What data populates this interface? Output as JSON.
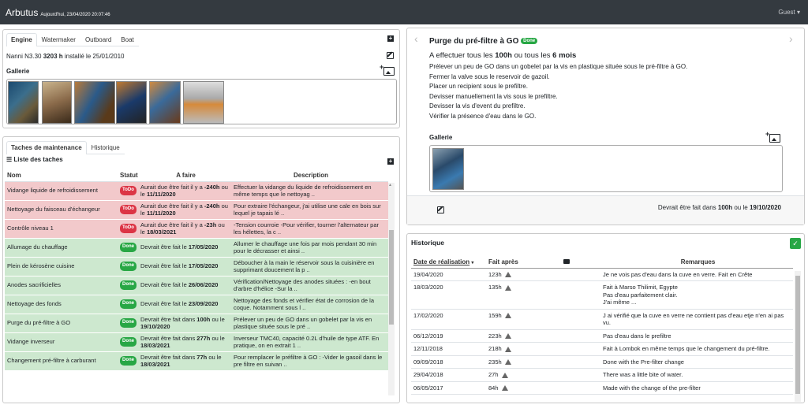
{
  "app": {
    "title": "Arbutus",
    "date": "Aujourd'hui, 23/04/2020 20:07:46",
    "user": "Guest"
  },
  "engine_card": {
    "tabs": [
      "Engine",
      "Watermaker",
      "Outboard",
      "Boat"
    ],
    "engine_model": "Nanni N3.30",
    "engine_hours": "3203 h",
    "installed_text": "installé le 25/01/2010",
    "gallery_label": "Gallerie"
  },
  "tasks_card": {
    "tabs": [
      "Taches de maintenance",
      "Historique"
    ],
    "list_title": "Liste des taches",
    "headers": [
      "Nom",
      "Statut",
      "A faire",
      "Description"
    ],
    "rows": [
      {
        "name": "Vidange liquide de refroidissement",
        "status": "ToDo",
        "todo_pre": "Aurait due être fait il y a",
        "todo_bold": "-240h",
        "todo_mid": "ou le",
        "todo_date": "11/11/2020",
        "description": "Effectuer la vidange du liquide de refroidissement en même temps que le nettoyag ..",
        "state": "red"
      },
      {
        "name": "Nettoyage du faisceau d'échangeur",
        "status": "ToDo",
        "todo_pre": "Aurait due être fait il y a",
        "todo_bold": "-240h",
        "todo_mid": "ou le",
        "todo_date": "11/11/2020",
        "description": "Pour extraire l'échangeur, j'ai utilise une cale en bois sur lequel je tapais lé ..",
        "state": "red"
      },
      {
        "name": "Contrôle niveau 1",
        "status": "ToDo",
        "todo_pre": "Aurait due être fait il y a",
        "todo_bold": "-23h",
        "todo_mid": "ou le",
        "todo_date": "18/03/2021",
        "description": "-Tension courroie -Pour vérifier, tourner l'alternateur par les hélettes, la c ..",
        "state": "red"
      },
      {
        "name": "Allumage du chauffage",
        "status": "Done",
        "todo_pre": "Devrait être fait le",
        "todo_bold": "",
        "todo_mid": "",
        "todo_date": "17/05/2020",
        "description": "Allumer le chauffage une fois par mois pendant 30 min pour le décrasser et ainsi ..",
        "state": "green"
      },
      {
        "name": "Plein de kérosène cuisine",
        "status": "Done",
        "todo_pre": "Devrait être fait le",
        "todo_bold": "",
        "todo_mid": "",
        "todo_date": "17/05/2020",
        "description": "Déboucher à la main le réservoir sous la cuisinière en supprimant doucement la p ..",
        "state": "green"
      },
      {
        "name": "Anodes sacrificielles",
        "status": "Done",
        "todo_pre": "Devrait être fait le",
        "todo_bold": "",
        "todo_mid": "",
        "todo_date": "26/06/2020",
        "description": "Vérification/Nettoyage des anodes situées : -en bout d'arbre d'hélice -Sur la ..",
        "state": "green"
      },
      {
        "name": "Nettoyage des fonds",
        "status": "Done",
        "todo_pre": "Devrait être fait le",
        "todo_bold": "",
        "todo_mid": "",
        "todo_date": "23/09/2020",
        "description": "Nettoyage des fonds et vérifier état de corrosion de la coque. Notamment sous l ..",
        "state": "green"
      },
      {
        "name": "Purge du pré-filtre à GO",
        "status": "Done",
        "todo_pre": "Devrait être fait dans",
        "todo_bold": "100h",
        "todo_mid": "ou le",
        "todo_date": "19/10/2020",
        "description": "Prélever un peu de GO dans un gobelet par la vis en plastique située sous le pré ..",
        "state": "green"
      },
      {
        "name": "Vidange inverseur",
        "status": "Done",
        "todo_pre": "Devrait être fait dans",
        "todo_bold": "277h",
        "todo_mid": "ou le",
        "todo_date": "18/03/2021",
        "description": "Inverseur TMC40, capacité 0.2L d'huile de type ATF. En pratique, on en extrait 1 ..",
        "state": "green"
      },
      {
        "name": "Changement pré-filtre à carburant",
        "status": "Done",
        "todo_pre": "Devrait être fait dans",
        "todo_bold": "77h",
        "todo_mid": "ou le",
        "todo_date": "18/03/2021",
        "description": "Pour remplacer le préfiltre à GO : -Vider le gasoil dans le pre filtre en suivan ..",
        "state": "green"
      }
    ]
  },
  "detail_card": {
    "title": "Purge du pré-filtre à GO",
    "badge": "Done",
    "freq_pre": "A effectuer tous les",
    "freq_hours": "100h",
    "freq_mid": "ou tous les",
    "freq_months": "6 mois",
    "steps": [
      "Prélever un peu de GO dans un gobelet par la vis en plastique située sous le pré-filtre à GO.",
      "Fermer la valve sous le reservoir de gazoil.",
      "Placer un recipient sous le prefiltre.",
      "Devisser manuellement la vis sous le prefiltre.",
      "Devisser la vis d'event du prefiltre.",
      "Vérifier la présence d'eau dans le GO."
    ],
    "gallery_label": "Gallerie",
    "due_pre": "Devrait être fait dans",
    "due_hours": "100h",
    "due_mid": "ou le",
    "due_date": "19/10/2020"
  },
  "history_card": {
    "title": "Historique",
    "headers": [
      "Date de réalisation",
      "Fait après",
      "Remarques"
    ],
    "rows": [
      {
        "date": "19/04/2020",
        "after": "123h",
        "remarks": [
          "Je ne vois pas d'eau dans la cuve en verre. Fait en Crête"
        ]
      },
      {
        "date": "18/03/2020",
        "after": "135h",
        "remarks": [
          "Fait à Marso Thilimit, Egypte",
          "Pas d'eau parfaitement clair.",
          "J'ai même ..."
        ]
      },
      {
        "date": "17/02/2020",
        "after": "159h",
        "remarks": [
          "J ai vérifié que la cuve en verre ne contient pas d'eau etje n'en ai pas vu."
        ]
      },
      {
        "date": "06/12/2019",
        "after": "223h",
        "remarks": [
          "Pas d'eau dans le prefiltre"
        ]
      },
      {
        "date": "12/11/2018",
        "after": "218h",
        "remarks": [
          "Fait à Lombok en même temps que le changement du pré-filtre."
        ]
      },
      {
        "date": "09/09/2018",
        "after": "235h",
        "remarks": [
          "Done with the Pre-filter change"
        ]
      },
      {
        "date": "29/04/2018",
        "after": "27h",
        "remarks": [
          "There was a little bite of water."
        ]
      },
      {
        "date": "06/05/2017",
        "after": "84h",
        "remarks": [
          "Made with the change of the pre-filter"
        ]
      }
    ]
  },
  "icons": [
    "plus-icon",
    "edit-icon",
    "gallery-add-icon",
    "camera-icon",
    "warning-icon",
    "chevron-left-icon",
    "chevron-right-icon",
    "check-icon",
    "list-icon"
  ]
}
